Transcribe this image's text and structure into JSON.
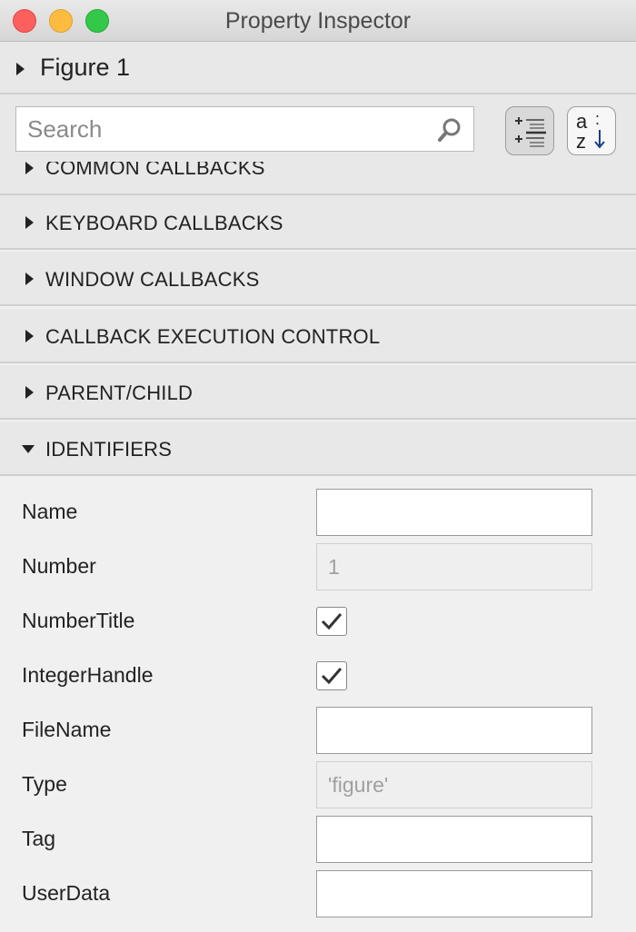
{
  "window": {
    "title": "Property Inspector"
  },
  "object": {
    "label": "Figure 1"
  },
  "search": {
    "placeholder": "Search",
    "value": ""
  },
  "toolbar": {
    "alpha_top": "a",
    "alpha_bottom": "z",
    "alpha_colon": ":",
    "categorized_selected": true
  },
  "sections": [
    {
      "label": "COMMON CALLBACKS",
      "expanded": false
    },
    {
      "label": "KEYBOARD CALLBACKS",
      "expanded": false
    },
    {
      "label": "WINDOW CALLBACKS",
      "expanded": false
    },
    {
      "label": "CALLBACK EXECUTION CONTROL",
      "expanded": false
    },
    {
      "label": "PARENT/CHILD",
      "expanded": false
    },
    {
      "label": "IDENTIFIERS",
      "expanded": true
    }
  ],
  "properties": [
    {
      "label": "Name",
      "type": "text",
      "value": ""
    },
    {
      "label": "Number",
      "type": "readonly",
      "value": "1"
    },
    {
      "label": "NumberTitle",
      "type": "checkbox",
      "checked": true
    },
    {
      "label": "IntegerHandle",
      "type": "checkbox",
      "checked": true
    },
    {
      "label": "FileName",
      "type": "text",
      "value": ""
    },
    {
      "label": "Type",
      "type": "readonly",
      "value": "'figure'"
    },
    {
      "label": "Tag",
      "type": "text",
      "value": ""
    },
    {
      "label": "UserData",
      "type": "text",
      "value": ""
    }
  ],
  "colors": {
    "close": "#fc605c",
    "minimize": "#fdbc40",
    "maximize": "#34c84a",
    "panel": "#e8e8e8",
    "background": "#f0f0f0"
  }
}
